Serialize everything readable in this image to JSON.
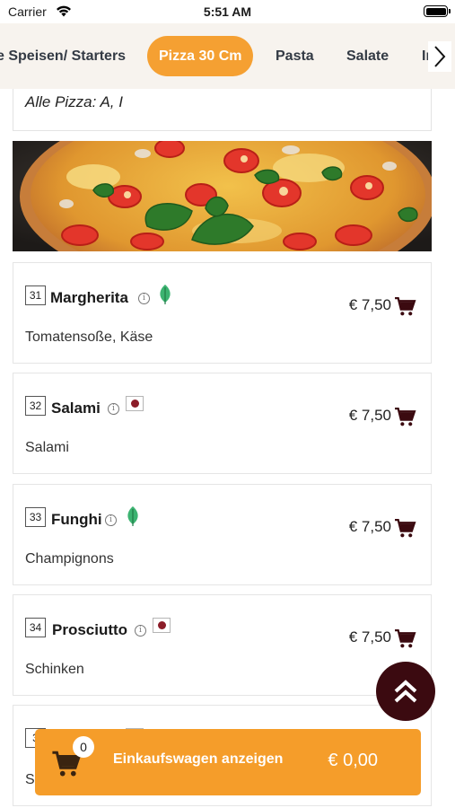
{
  "status": {
    "carrier": "Carrier",
    "time": "5:51 AM"
  },
  "categories": [
    {
      "label": "e Speisen/ Starters",
      "active": false
    },
    {
      "label": "Pizza 30 Cm",
      "active": true
    },
    {
      "label": "Pasta",
      "active": false
    },
    {
      "label": "Salate",
      "active": false
    },
    {
      "label": "In",
      "active": false
    }
  ],
  "allergens": {
    "text": "Alle Pizza: A, I"
  },
  "items": [
    {
      "number": "31",
      "name": "Margherita",
      "description": "Tomatensoße, Käse",
      "price": "€ 7,50",
      "badge": "vegetarian-leaf"
    },
    {
      "number": "32",
      "name": "Salami",
      "description": "Salami",
      "price": "€ 7,50",
      "badge": "meat"
    },
    {
      "number": "33",
      "name": "Funghi",
      "description": "Champignons",
      "price": "€ 7,50",
      "badge": "vegetarian-leaf"
    },
    {
      "number": "34",
      "name": "Prosciutto",
      "description": "Schinken",
      "price": "€ 7,50",
      "badge": "meat"
    },
    {
      "number": "3",
      "name": "",
      "description": "S",
      "price": "",
      "badge": "meat"
    }
  ],
  "cart": {
    "count": "0",
    "label": "Einkaufswagen anzeigen",
    "total": "€ 0,00"
  },
  "colors": {
    "accent": "#f5a032",
    "dark": "#3b0a10",
    "leaf": "#3cb371",
    "meat": "#8b1c28"
  }
}
